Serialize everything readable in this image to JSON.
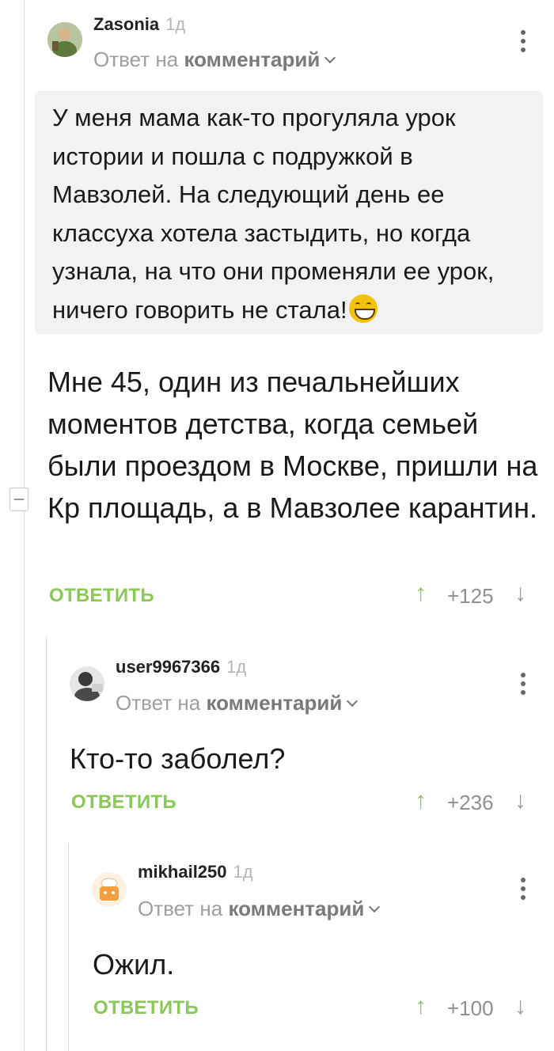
{
  "comments": [
    {
      "username": "Zasonia",
      "time": "1д",
      "reply_prefix": "Ответ на",
      "reply_target": "комментарий",
      "quote": "У меня мама как-то прогуляла урок истории и пошла с подружкой в Мавзолей. На следующий день ее классуха хотела застыдить, но когда узнала, на что они променяли ее урок, ничего говорить не стала!",
      "quote_emoji": "grinning-face-emoji",
      "text": "Мне 45, один из печальнейших моментов детства, когда семьей были проездом в Москве, пришли на Кр площадь, а в Мавзолее карантин.",
      "reply_label": "ОТВЕТИТЬ",
      "score": "+125"
    },
    {
      "username": "user9967366",
      "time": "1д",
      "reply_prefix": "Ответ на",
      "reply_target": "комментарий",
      "text": "Кто-то заболел?",
      "reply_label": "ОТВЕТИТЬ",
      "score": "+236"
    },
    {
      "username": "mikhail250",
      "time": "1д",
      "reply_prefix": "Ответ на",
      "reply_target": "комментарий",
      "text": "Ожил.",
      "reply_label": "ОТВЕТИТЬ",
      "score": "+100"
    }
  ],
  "icons": {
    "upvote": "arrow-up-icon",
    "downvote": "arrow-down-icon",
    "menu": "more-vertical-icon",
    "collapse": "minus-icon",
    "expand_reply": "chevron-down-icon"
  },
  "colors": {
    "accent": "#8ac858",
    "quote_bg": "#f2f2f2",
    "muted": "#9e9e9e"
  }
}
